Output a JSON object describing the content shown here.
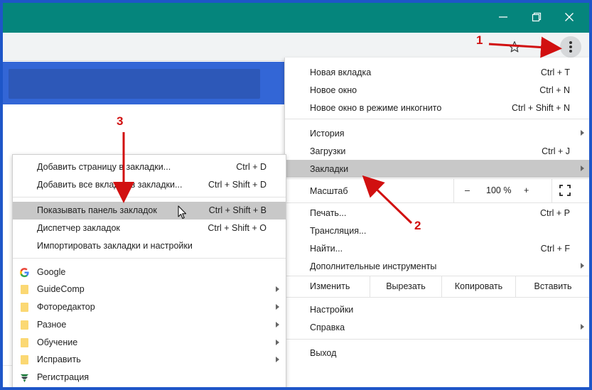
{
  "window": {
    "controls": [
      "minimize-icon",
      "maximize-icon",
      "close-icon"
    ],
    "title_bar_color": "#05857c"
  },
  "toolbar": {
    "icons": [
      "star-icon",
      "extension-icon",
      "menu-dots-icon"
    ]
  },
  "main_menu": {
    "items": [
      {
        "label": "Новая вкладка",
        "shortcut": "Ctrl + T"
      },
      {
        "label": "Новое окно",
        "shortcut": "Ctrl + N"
      },
      {
        "label": "Новое окно в режиме инкогнито",
        "shortcut": "Ctrl + Shift + N"
      },
      {
        "label": "История",
        "shortcut": ""
      },
      {
        "label": "Загрузки",
        "shortcut": "Ctrl + J"
      },
      {
        "label": "Закладки",
        "shortcut": ""
      },
      {
        "label": "Печать...",
        "shortcut": "Ctrl + P"
      },
      {
        "label": "Трансляция...",
        "shortcut": ""
      },
      {
        "label": "Найти...",
        "shortcut": "Ctrl + F"
      },
      {
        "label": "Дополнительные инструменты",
        "shortcut": ""
      },
      {
        "label": "Настройки",
        "shortcut": ""
      },
      {
        "label": "Справка",
        "shortcut": ""
      },
      {
        "label": "Выход",
        "shortcut": ""
      }
    ],
    "zoom": {
      "label": "Масштаб",
      "minus": "–",
      "value": "100 %",
      "plus": "+"
    },
    "edit": {
      "label": "Изменить",
      "cut": "Вырезать",
      "copy": "Копировать",
      "paste": "Вставить"
    },
    "highlighted": "Закладки"
  },
  "bookmarks_menu": {
    "actions": [
      {
        "label": "Добавить страницу в закладки...",
        "shortcut": "Ctrl + D"
      },
      {
        "label": "Добавить все вкладки в закладки...",
        "shortcut": "Ctrl + Shift + D"
      },
      {
        "label": "Показывать панель закладок",
        "shortcut": "Ctrl + Shift + B"
      },
      {
        "label": "Диспетчер закладок",
        "shortcut": "Ctrl + Shift + O"
      },
      {
        "label": "Импортировать закладки и настройки",
        "shortcut": ""
      }
    ],
    "bookmarks": [
      {
        "label": "Google",
        "icon": "google-icon"
      },
      {
        "label": "GuideComp",
        "icon": "folder-icon"
      },
      {
        "label": "Фоторедактор",
        "icon": "folder-icon"
      },
      {
        "label": "Разное",
        "icon": "folder-icon"
      },
      {
        "label": "Обучение",
        "icon": "folder-icon"
      },
      {
        "label": "Исправить",
        "icon": "folder-icon"
      },
      {
        "label": "Регистрация",
        "icon": "site-icon"
      }
    ],
    "highlighted": "Показывать панель закладок"
  },
  "annotations": {
    "step1": "1",
    "step2": "2",
    "step3": "3",
    "color": "#d11010"
  }
}
